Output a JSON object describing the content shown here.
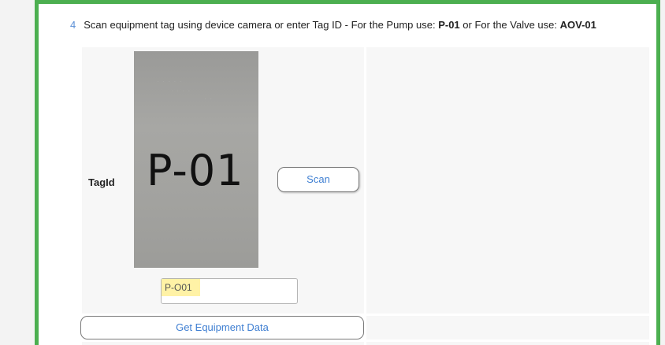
{
  "instruction": {
    "step_number": "4",
    "text_before_pump": "Scan equipment tag using device camera or enter Tag ID - For the Pump use:",
    "pump_tag": "P-01",
    "text_between": "or For the Valve use:",
    "valve_tag": "AOV-01"
  },
  "form": {
    "tag_label": "TagId",
    "camera_preview_text": "P-01",
    "scan_button_label": "Scan",
    "tag_input_value": "P-O01",
    "get_equipment_button_label": "Get Equipment Data"
  },
  "colors": {
    "frame_border": "#4caf50",
    "button_text": "#3f7fd2",
    "step_number": "#5b8fd6",
    "input_highlight": "#fff2a6"
  }
}
